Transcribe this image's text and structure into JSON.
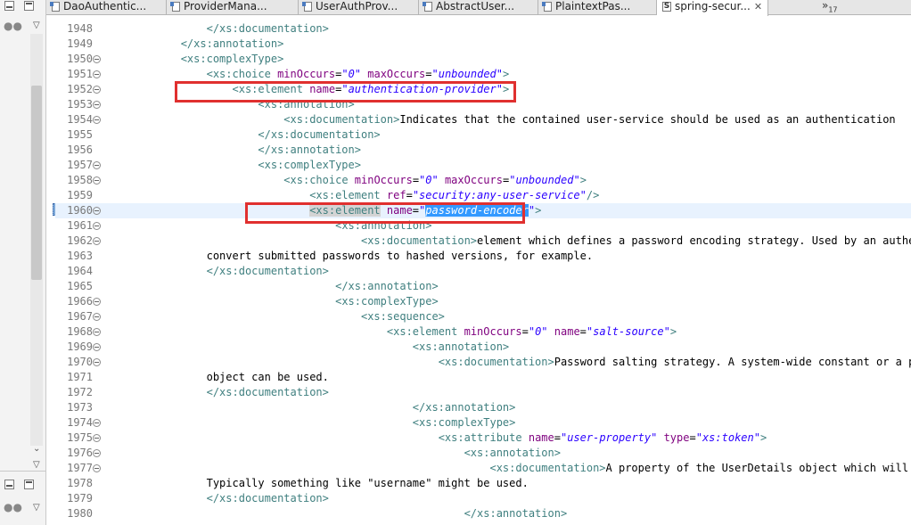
{
  "tabs": [
    {
      "label": "DaoAuthentic...",
      "icon": "java-file-icon"
    },
    {
      "label": "ProviderMana...",
      "icon": "java-file-icon"
    },
    {
      "label": "UserAuthProv...",
      "icon": "java-file-icon"
    },
    {
      "label": "AbstractUser...",
      "icon": "java-file-icon"
    },
    {
      "label": "PlaintextPas...",
      "icon": "java-file-icon"
    },
    {
      "label": "spring-secur...",
      "icon": "schema-file-icon",
      "active": true
    }
  ],
  "tab_close": "✕",
  "overflow": {
    "glyph": "»",
    "count": "17"
  },
  "editor": {
    "lines": [
      {
        "n": "1948",
        "fold": false,
        "parts": [
          {
            "t": "                "
          },
          {
            "c": "t",
            "t": "</xs:documentation>"
          }
        ]
      },
      {
        "n": "1949",
        "fold": false,
        "parts": [
          {
            "t": "            "
          },
          {
            "c": "t",
            "t": "</xs:annotation>"
          }
        ]
      },
      {
        "n": "1950",
        "fold": true,
        "parts": [
          {
            "t": "            "
          },
          {
            "c": "t",
            "t": "<xs:complexType>"
          }
        ]
      },
      {
        "n": "1951",
        "fold": true,
        "parts": [
          {
            "t": "                "
          },
          {
            "c": "t",
            "t": "<xs:choice "
          },
          {
            "c": "an",
            "t": "minOccurs"
          },
          {
            "c": "tx",
            "t": "="
          },
          {
            "c": "av",
            "t": "\"0\""
          },
          {
            "c": "an",
            "t": " maxOccurs"
          },
          {
            "c": "tx",
            "t": "="
          },
          {
            "c": "av",
            "t": "\"unbounded\""
          },
          {
            "c": "t",
            "t": ">"
          }
        ]
      },
      {
        "n": "1952",
        "fold": true,
        "parts": [
          {
            "t": "                    "
          },
          {
            "c": "t",
            "t": "<xs:element "
          },
          {
            "c": "an",
            "t": "name"
          },
          {
            "c": "tx",
            "t": "="
          },
          {
            "c": "av",
            "t": "\"authentication-provider\""
          },
          {
            "c": "t",
            "t": ">"
          }
        ]
      },
      {
        "n": "1953",
        "fold": true,
        "parts": [
          {
            "t": "                        "
          },
          {
            "c": "t",
            "t": "<xs:annotation>"
          }
        ]
      },
      {
        "n": "1954",
        "fold": true,
        "parts": [
          {
            "t": "                            "
          },
          {
            "c": "t",
            "t": "<xs:documentation>"
          },
          {
            "c": "tx",
            "t": "Indicates that the contained user-service should be used as an authentication"
          }
        ]
      },
      {
        "n": "1955",
        "fold": false,
        "parts": [
          {
            "t": "                        "
          },
          {
            "c": "t",
            "t": "</xs:documentation>"
          }
        ]
      },
      {
        "n": "1956",
        "fold": false,
        "parts": [
          {
            "t": "                        "
          },
          {
            "c": "t",
            "t": "</xs:annotation>"
          }
        ]
      },
      {
        "n": "1957",
        "fold": true,
        "parts": [
          {
            "t": "                        "
          },
          {
            "c": "t",
            "t": "<xs:complexType>"
          }
        ]
      },
      {
        "n": "1958",
        "fold": true,
        "parts": [
          {
            "t": "                            "
          },
          {
            "c": "t",
            "t": "<xs:choice "
          },
          {
            "c": "an",
            "t": "minOccurs"
          },
          {
            "c": "tx",
            "t": "="
          },
          {
            "c": "av",
            "t": "\"0\""
          },
          {
            "c": "an",
            "t": " maxOccurs"
          },
          {
            "c": "tx",
            "t": "="
          },
          {
            "c": "av",
            "t": "\"unbounded\""
          },
          {
            "c": "t",
            "t": ">"
          }
        ]
      },
      {
        "n": "1959",
        "fold": false,
        "parts": [
          {
            "t": "                                "
          },
          {
            "c": "t",
            "t": "<xs:element "
          },
          {
            "c": "an",
            "t": "ref"
          },
          {
            "c": "tx",
            "t": "="
          },
          {
            "c": "av",
            "t": "\"security:any-user-service\""
          },
          {
            "c": "t",
            "t": "/>"
          }
        ]
      },
      {
        "n": "1960",
        "fold": true,
        "current": true,
        "parts": [
          {
            "t": "                                "
          },
          {
            "c": "t hl",
            "t": "<xs:element"
          },
          {
            "c": "an",
            "t": " name"
          },
          {
            "c": "tx",
            "t": "="
          },
          {
            "c": "av",
            "t": "\""
          },
          {
            "c": "sel",
            "t": "password-encoder"
          },
          {
            "c": "av",
            "t": "\""
          },
          {
            "c": "t",
            "t": ">"
          }
        ]
      },
      {
        "n": "1961",
        "fold": true,
        "parts": [
          {
            "t": "                                    "
          },
          {
            "c": "t",
            "t": "<xs:annotation>"
          }
        ]
      },
      {
        "n": "1962",
        "fold": true,
        "parts": [
          {
            "t": "                                        "
          },
          {
            "c": "t",
            "t": "<xs:documentation>"
          },
          {
            "c": "tx",
            "t": "element which defines a password encoding strategy. Used by an authen"
          }
        ]
      },
      {
        "n": "1963",
        "fold": false,
        "parts": [
          {
            "t": "                "
          },
          {
            "c": "tx",
            "t": "convert submitted passwords to hashed versions, for example."
          }
        ]
      },
      {
        "n": "1964",
        "fold": false,
        "parts": [
          {
            "t": "                "
          },
          {
            "c": "t",
            "t": "</xs:documentation>"
          }
        ]
      },
      {
        "n": "1965",
        "fold": false,
        "parts": [
          {
            "t": "                                    "
          },
          {
            "c": "t",
            "t": "</xs:annotation>"
          }
        ]
      },
      {
        "n": "1966",
        "fold": true,
        "parts": [
          {
            "t": "                                    "
          },
          {
            "c": "t",
            "t": "<xs:complexType>"
          }
        ]
      },
      {
        "n": "1967",
        "fold": true,
        "parts": [
          {
            "t": "                                        "
          },
          {
            "c": "t",
            "t": "<xs:sequence>"
          }
        ]
      },
      {
        "n": "1968",
        "fold": true,
        "parts": [
          {
            "t": "                                            "
          },
          {
            "c": "t",
            "t": "<xs:element "
          },
          {
            "c": "an",
            "t": "minOccurs"
          },
          {
            "c": "tx",
            "t": "="
          },
          {
            "c": "av",
            "t": "\"0\""
          },
          {
            "c": "an",
            "t": " name"
          },
          {
            "c": "tx",
            "t": "="
          },
          {
            "c": "av",
            "t": "\"salt-source\""
          },
          {
            "c": "t",
            "t": ">"
          }
        ]
      },
      {
        "n": "1969",
        "fold": true,
        "parts": [
          {
            "t": "                                                "
          },
          {
            "c": "t",
            "t": "<xs:annotation>"
          }
        ]
      },
      {
        "n": "1970",
        "fold": true,
        "parts": [
          {
            "t": "                                                    "
          },
          {
            "c": "t",
            "t": "<xs:documentation>"
          },
          {
            "c": "tx",
            "t": "Password salting strategy. A system-wide constant or a prope"
          }
        ]
      },
      {
        "n": "1971",
        "fold": false,
        "parts": [
          {
            "t": "                "
          },
          {
            "c": "tx",
            "t": "object can be used."
          }
        ]
      },
      {
        "n": "1972",
        "fold": false,
        "parts": [
          {
            "t": "                "
          },
          {
            "c": "t",
            "t": "</xs:documentation>"
          }
        ]
      },
      {
        "n": "1973",
        "fold": false,
        "parts": [
          {
            "t": "                                                "
          },
          {
            "c": "t",
            "t": "</xs:annotation>"
          }
        ]
      },
      {
        "n": "1974",
        "fold": true,
        "parts": [
          {
            "t": "                                                "
          },
          {
            "c": "t",
            "t": "<xs:complexType>"
          }
        ]
      },
      {
        "n": "1975",
        "fold": true,
        "parts": [
          {
            "t": "                                                    "
          },
          {
            "c": "t",
            "t": "<xs:attribute "
          },
          {
            "c": "an",
            "t": "name"
          },
          {
            "c": "tx",
            "t": "="
          },
          {
            "c": "av",
            "t": "\"user-property\""
          },
          {
            "c": "an",
            "t": " type"
          },
          {
            "c": "tx",
            "t": "="
          },
          {
            "c": "av",
            "t": "\"xs:token\""
          },
          {
            "c": "t",
            "t": ">"
          }
        ]
      },
      {
        "n": "1976",
        "fold": true,
        "parts": [
          {
            "t": "                                                        "
          },
          {
            "c": "t",
            "t": "<xs:annotation>"
          }
        ]
      },
      {
        "n": "1977",
        "fold": true,
        "parts": [
          {
            "t": "                                                            "
          },
          {
            "c": "t",
            "t": "<xs:documentation>"
          },
          {
            "c": "tx",
            "t": "A property of the UserDetails object which will be use"
          }
        ]
      },
      {
        "n": "1978",
        "fold": false,
        "parts": [
          {
            "t": "                "
          },
          {
            "c": "tx",
            "t": "Typically something like \"username\" might be used."
          }
        ]
      },
      {
        "n": "1979",
        "fold": false,
        "parts": [
          {
            "t": "                "
          },
          {
            "c": "t",
            "t": "</xs:documentation>"
          }
        ]
      },
      {
        "n": "1980",
        "fold": false,
        "parts": [
          {
            "t": "                                                        "
          },
          {
            "c": "t",
            "t": "</xs:annotation>"
          }
        ]
      }
    ]
  },
  "colors": {
    "tag": "#3f7f7f",
    "attr_name": "#7f007f",
    "attr_value": "#2a00ff",
    "selection": "#3399ff",
    "annotation_box": "#e0302f"
  }
}
